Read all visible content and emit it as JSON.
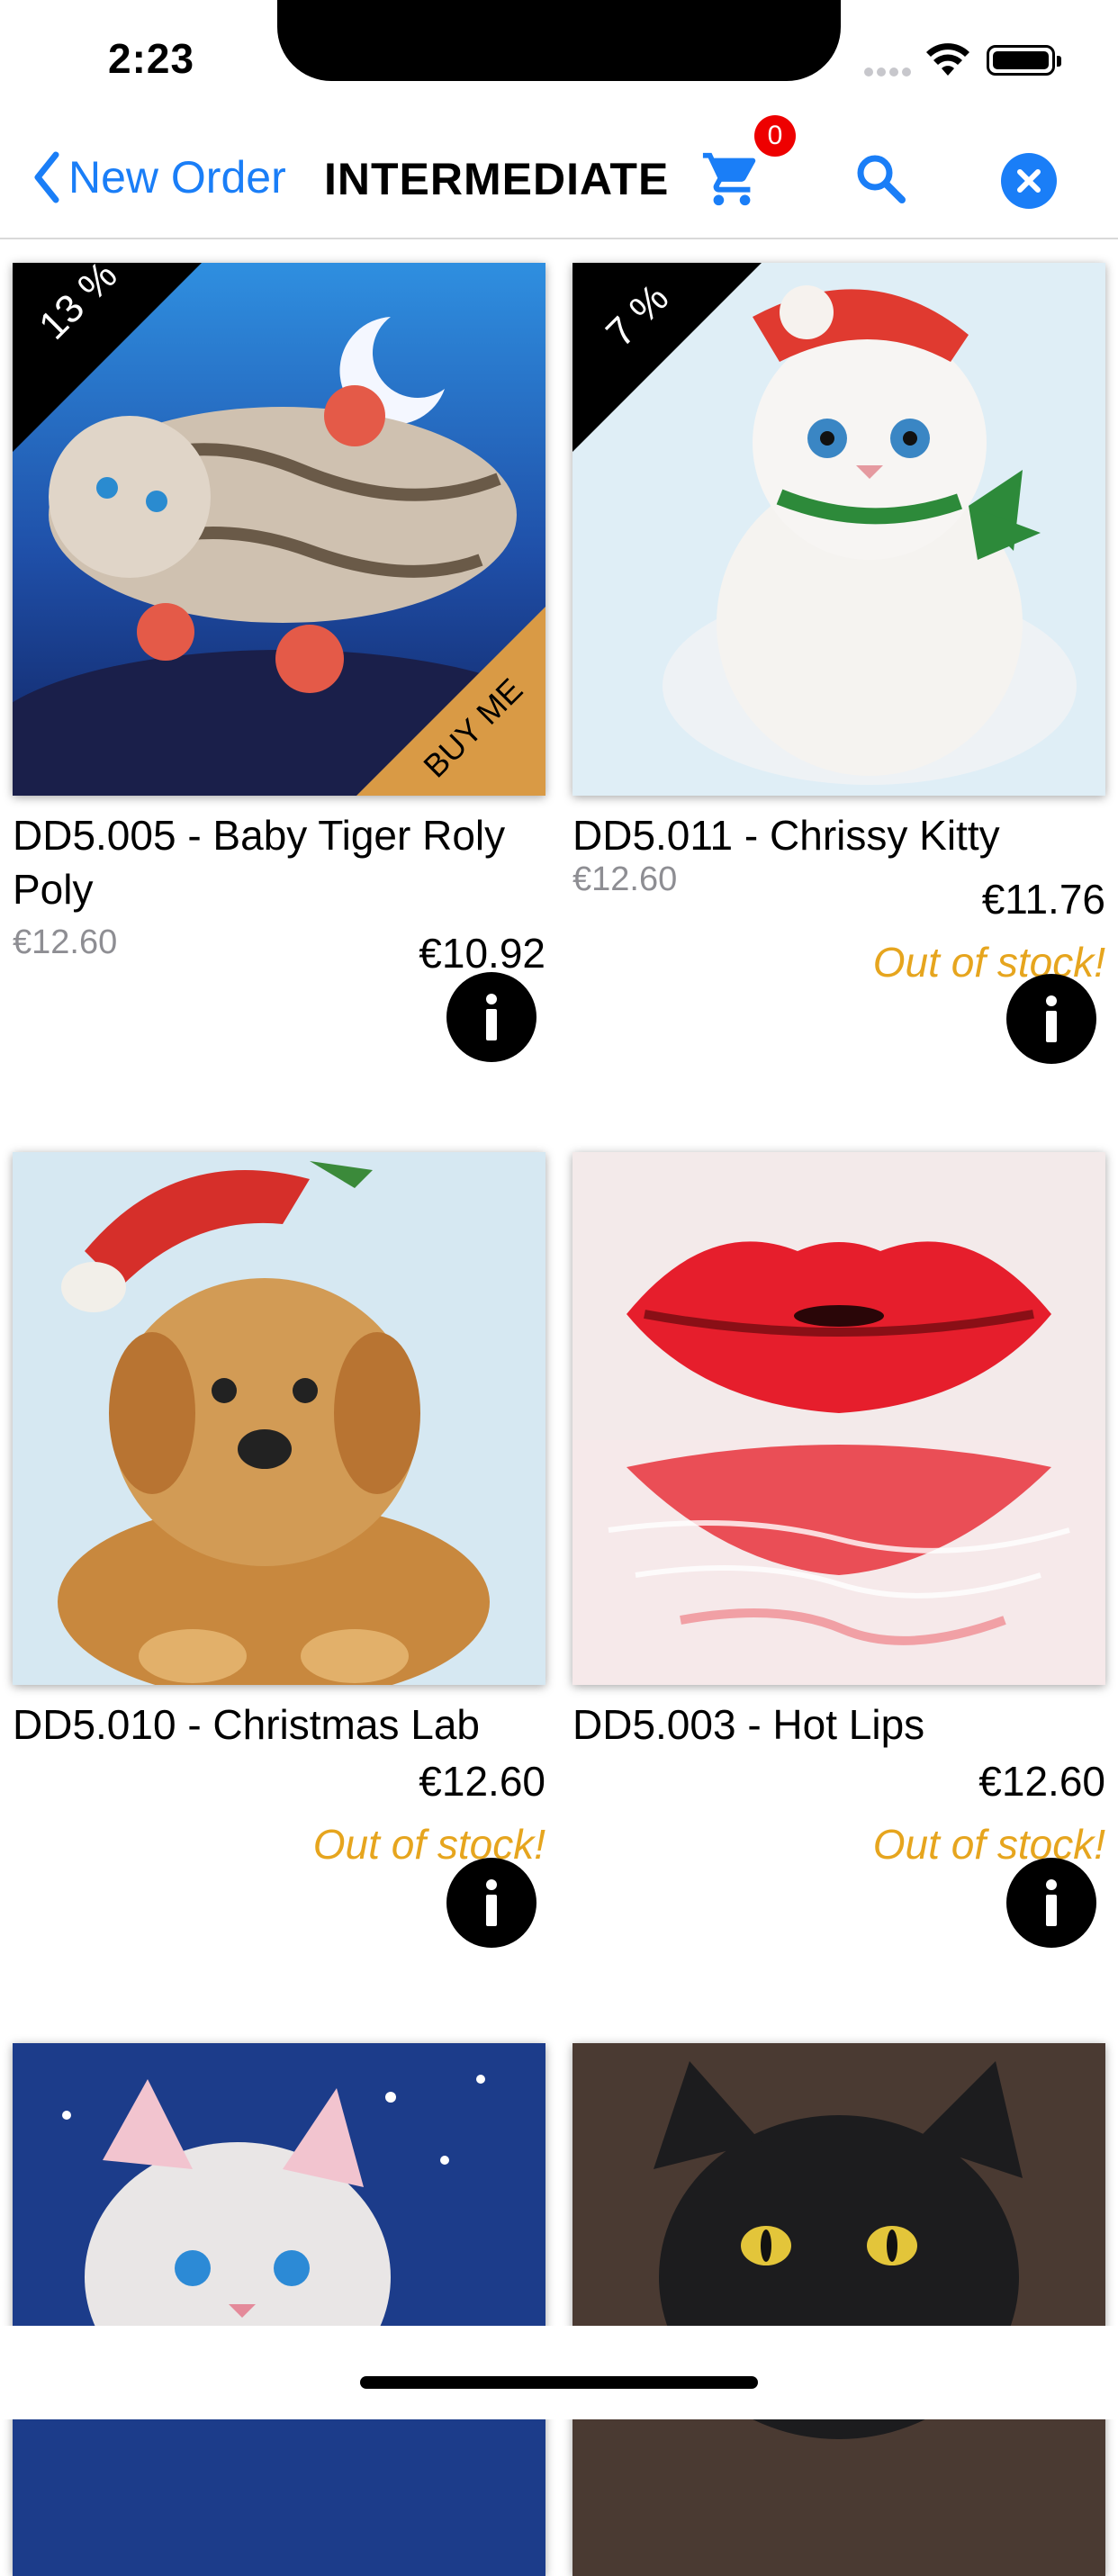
{
  "status_bar": {
    "time": "2:23"
  },
  "nav": {
    "back_label": "New Order",
    "title": "INTERMEDIATE",
    "cart_count": "0"
  },
  "colors": {
    "accent": "#1a7ef7",
    "out_of_stock": "#e6a51e",
    "badge": "#ee0000",
    "buy_me": "#d99a45"
  },
  "products": [
    {
      "name": "DD5.005 - Baby Tiger Roly Poly",
      "old_price": "€12.60",
      "price": "€10.92",
      "status": "",
      "discount": "13 %",
      "banner": "BUY ME",
      "image": "baby-tiger-image"
    },
    {
      "name": "DD5.011 - Chrissy Kitty",
      "old_price": "€12.60",
      "price": "€11.76",
      "status": "Out of stock!",
      "discount": "7 %",
      "banner": "",
      "image": "chrissy-kitty-image"
    },
    {
      "name": "DD5.010 - Christmas Lab",
      "old_price": "",
      "price": "€12.60",
      "status": "Out of stock!",
      "discount": "",
      "banner": "",
      "image": "christmas-lab-image"
    },
    {
      "name": "DD5.003 - Hot Lips",
      "old_price": "",
      "price": "€12.60",
      "status": "Out of stock!",
      "discount": "",
      "banner": "",
      "image": "hot-lips-image"
    },
    {
      "name": "",
      "old_price": "",
      "price": "",
      "status": "",
      "discount": "",
      "banner": "",
      "image": "snow-kitten-image"
    },
    {
      "name": "",
      "old_price": "",
      "price": "",
      "status": "",
      "discount": "",
      "banner": "",
      "image": "black-cat-image"
    }
  ]
}
